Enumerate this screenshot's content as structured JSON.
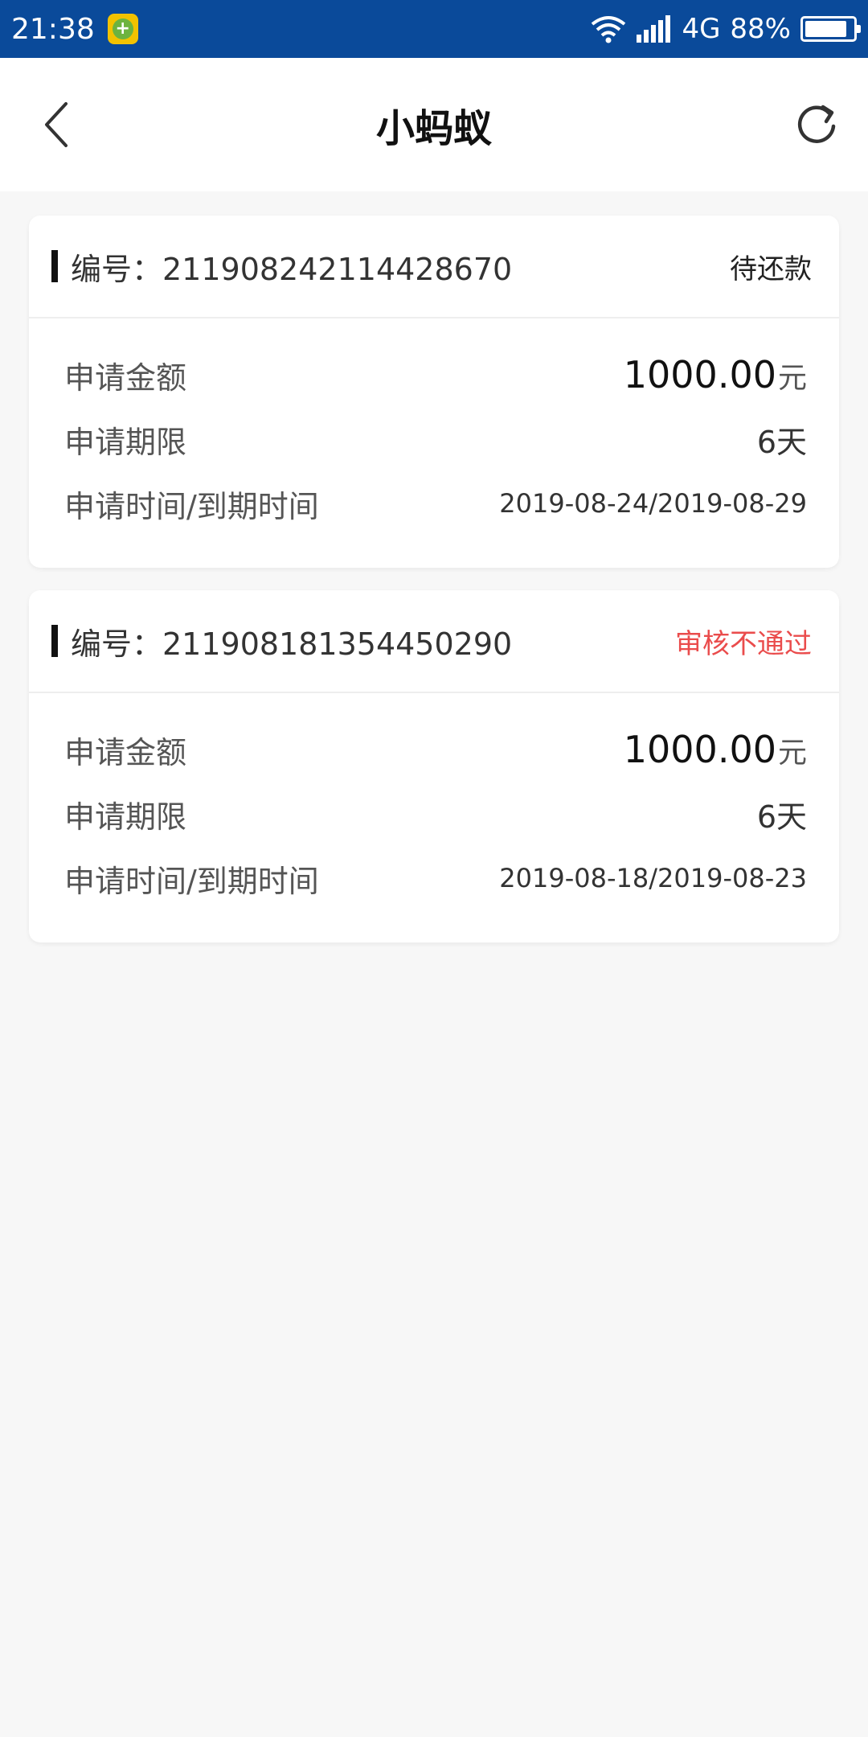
{
  "status_bar": {
    "time": "21:38",
    "network": "4G",
    "battery": "88%",
    "battery_level": 0.88
  },
  "header": {
    "title": "小蚂蚁",
    "back_icon": "chevron-left-icon",
    "refresh_icon": "refresh-icon"
  },
  "labels": {
    "amount": "申请金额",
    "term": "申请期限",
    "time": "申请时间/到期时间",
    "unit": "元"
  },
  "orders": [
    {
      "id_label": "编号：211908242114428670",
      "status": "待还款",
      "amount": "1000.00",
      "term": "6天",
      "dates": "2019-08-24/2019-08-29"
    },
    {
      "id_label": "编号：211908181354450290",
      "status": "审核不通过",
      "amount": "1000.00",
      "term": "6天",
      "dates": "2019-08-18/2019-08-23"
    }
  ],
  "colors": {
    "status_bar": "#0a4a9a",
    "reject": "#ea4c4c"
  }
}
